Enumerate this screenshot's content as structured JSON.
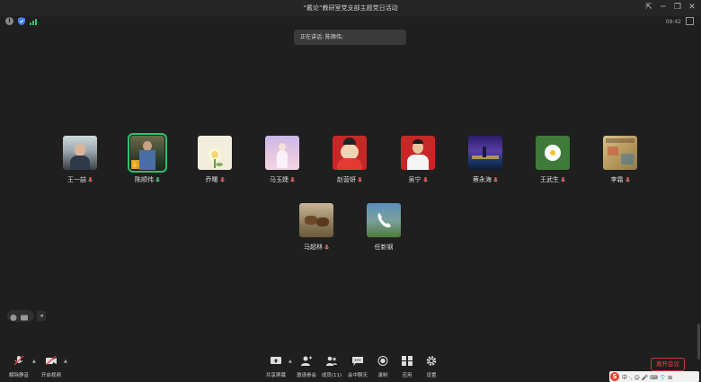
{
  "window": {
    "title": "“戴论”教研室党支部主题党日活动"
  },
  "status": {
    "time": "09:42"
  },
  "speaker": {
    "text": "正在讲话: 陈顺伟;"
  },
  "participants": [
    {
      "name": "王一喆",
      "avatar": "person-photo"
    },
    {
      "name": "陈顺伟",
      "avatar": "person-photo",
      "active": true
    },
    {
      "name": "乔曙",
      "avatar": "flower-photo"
    },
    {
      "name": "马玉婕",
      "avatar": "girl-illustration"
    },
    {
      "name": "赵营妍",
      "avatar": "cartoon-photo"
    },
    {
      "name": "吴宁",
      "avatar": "person-photo"
    },
    {
      "name": "蔡永海",
      "avatar": "night-scene"
    },
    {
      "name": "王武生",
      "avatar": "flower-photo"
    },
    {
      "name": "李霜",
      "avatar": "map-photo"
    },
    {
      "name": "马超林",
      "avatar": "animal-photo"
    },
    {
      "name": "任新钢",
      "avatar": "phone-icon"
    }
  ],
  "toolbar": {
    "unmute": "解除静音",
    "start_video": "开启视频",
    "share_screen": "共享屏幕",
    "invite": "邀请参会",
    "members": "成员(11)",
    "chat": "会中聊天",
    "record": "录制",
    "apps": "应用",
    "settings": "设置",
    "leave": "离开会议"
  },
  "ime": {
    "label": "中 ·, ☺ 🎤 ⌨ 👕 ⊞"
  },
  "colors": {
    "background": "#1f1f1f",
    "active": "#2ec26b",
    "leave": "#ee4444"
  }
}
